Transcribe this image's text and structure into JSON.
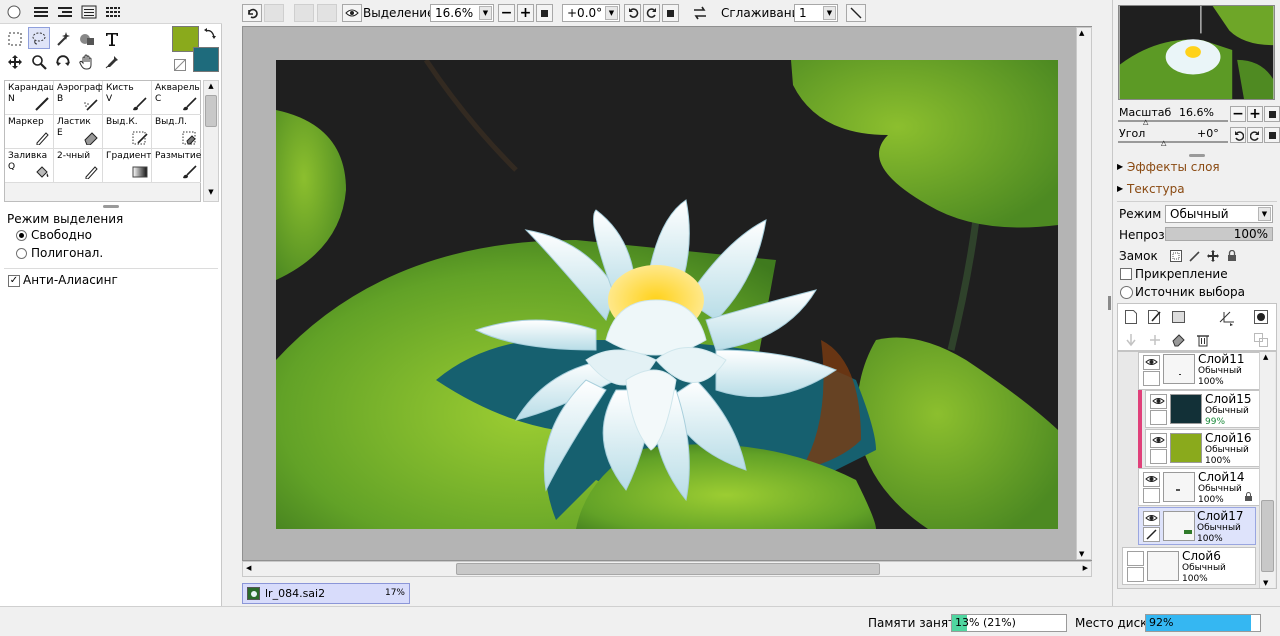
{
  "topbar": {
    "selection_label": "Выделение",
    "zoom_value": "16.6%",
    "angle_value": "+0.0°",
    "smoothing_label": "Сглаживание",
    "smoothing_value": "1"
  },
  "tool_panel": {
    "brushes": [
      {
        "name": "Карандаш",
        "key": "N"
      },
      {
        "name": "Аэрограф",
        "key": "B"
      },
      {
        "name": "Кисть",
        "key": "V"
      },
      {
        "name": "Акварель",
        "key": "C"
      },
      {
        "name": "Маркер",
        "key": ""
      },
      {
        "name": "Ластик",
        "key": "E"
      },
      {
        "name": "Выд.К.",
        "key": ""
      },
      {
        "name": "Выд.Л.",
        "key": ""
      },
      {
        "name": "Заливка",
        "key": "Q"
      },
      {
        "name": "2-чный",
        "key": ""
      },
      {
        "name": "Градиент",
        "key": ""
      },
      {
        "name": "Размытие",
        "key": ""
      }
    ],
    "selection_mode_label": "Режим выделения",
    "mode_free": "Свободно",
    "mode_polygon": "Полигонал.",
    "antialias_label": "Анти-Алиасинг",
    "primary_color": "#8aaa1c",
    "secondary_color": "#1e6b7c"
  },
  "document_tab": {
    "filename": "lr_084.sai2",
    "zoom": "17%"
  },
  "navigator": {
    "scale_label": "Масштаб",
    "scale_value": "16.6%",
    "angle_label": "Угол",
    "angle_value": "+0°"
  },
  "layer_panel": {
    "effects_label": "Эффекты слоя",
    "texture_label": "Текстура",
    "mode_label": "Режим",
    "mode_value": "Обычный",
    "opacity_label": "Непроз.",
    "opacity_value": "100%",
    "lock_label": "Замок",
    "clip_label": "Прикрепление",
    "source_label": "Источник выбора",
    "layers": [
      {
        "name": "Слой11",
        "mode": "Обычный",
        "opacity": "100%"
      },
      {
        "name": "Слой15",
        "mode": "Обычный",
        "opacity": "99%"
      },
      {
        "name": "Слой16",
        "mode": "Обычный",
        "opacity": "100%"
      },
      {
        "name": "Слой14",
        "mode": "Обычный",
        "opacity": "100%"
      },
      {
        "name": "Слой17",
        "mode": "Обычный",
        "opacity": "100%"
      },
      {
        "name": "Слой6",
        "mode": "Обычный",
        "opacity": "100%"
      }
    ]
  },
  "status": {
    "memory_label": "Памяти занято",
    "memory_value": "13% (21%)",
    "memory_fraction": 0.13,
    "disk_label": "Место диска",
    "disk_value": "92%",
    "disk_fraction": 0.92
  }
}
